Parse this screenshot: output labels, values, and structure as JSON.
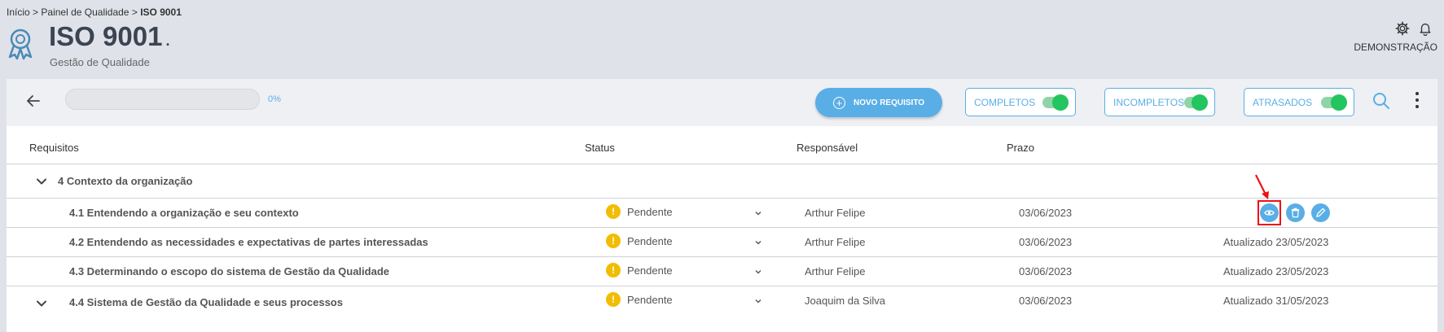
{
  "breadcrumb": {
    "home": "Início",
    "sep1": ">",
    "middle": "Painel de Qualidade",
    "sep2": ">",
    "current": "ISO 9001"
  },
  "header": {
    "title": "ISO 9001",
    "title_dot": ".",
    "subtitle": "Gestão de Qualidade",
    "user": "DEMONSTRAÇÃO"
  },
  "toolbar": {
    "progress_value": 0,
    "progress_label": "0%",
    "new_button": "NOVO REQUISITO",
    "filters": [
      {
        "label": "COMPLETOS",
        "on": true
      },
      {
        "label": "INCOMPLETOS",
        "on": true
      },
      {
        "label": "ATRASADOS",
        "on": true
      }
    ]
  },
  "columns": {
    "req": "Requisitos",
    "status": "Status",
    "resp": "Responsável",
    "due": "Prazo"
  },
  "groups": [
    {
      "title": "4 Contexto da organização"
    }
  ],
  "rows": [
    {
      "req": "4.1 Entendendo a organização e seu contexto",
      "status": "Pendente",
      "resp": "Arthur Felipe",
      "due": "03/06/2023",
      "updated": ""
    },
    {
      "req": "4.2 Entendendo as necessidades e expectativas de partes interessadas",
      "status": "Pendente",
      "resp": "Arthur Felipe",
      "due": "03/06/2023",
      "updated": "Atualizado 23/05/2023"
    },
    {
      "req": "4.3 Determinando o escopo do sistema de Gestão da Qualidade",
      "status": "Pendente",
      "resp": "Arthur Felipe",
      "due": "03/06/2023",
      "updated": "Atualizado 23/05/2023"
    },
    {
      "req": "4.4 Sistema de Gestão da Qualidade e seus processos",
      "status": "Pendente",
      "resp": "Joaquim da Silva",
      "due": "03/06/2023",
      "updated": "Atualizado 31/05/2023"
    }
  ],
  "status_icon": "!",
  "colors": {
    "accent": "#5aaee6",
    "toggle": "#22c55e",
    "warning": "#f2bd00",
    "highlight": "#e11111"
  },
  "icons": [
    "award-icon",
    "gear-icon",
    "bell-icon",
    "back-arrow-icon",
    "plus-circle-icon",
    "search-icon",
    "more-vertical-icon",
    "chevron-down-icon",
    "warning-icon",
    "eye-icon",
    "trash-icon",
    "edit-icon"
  ]
}
